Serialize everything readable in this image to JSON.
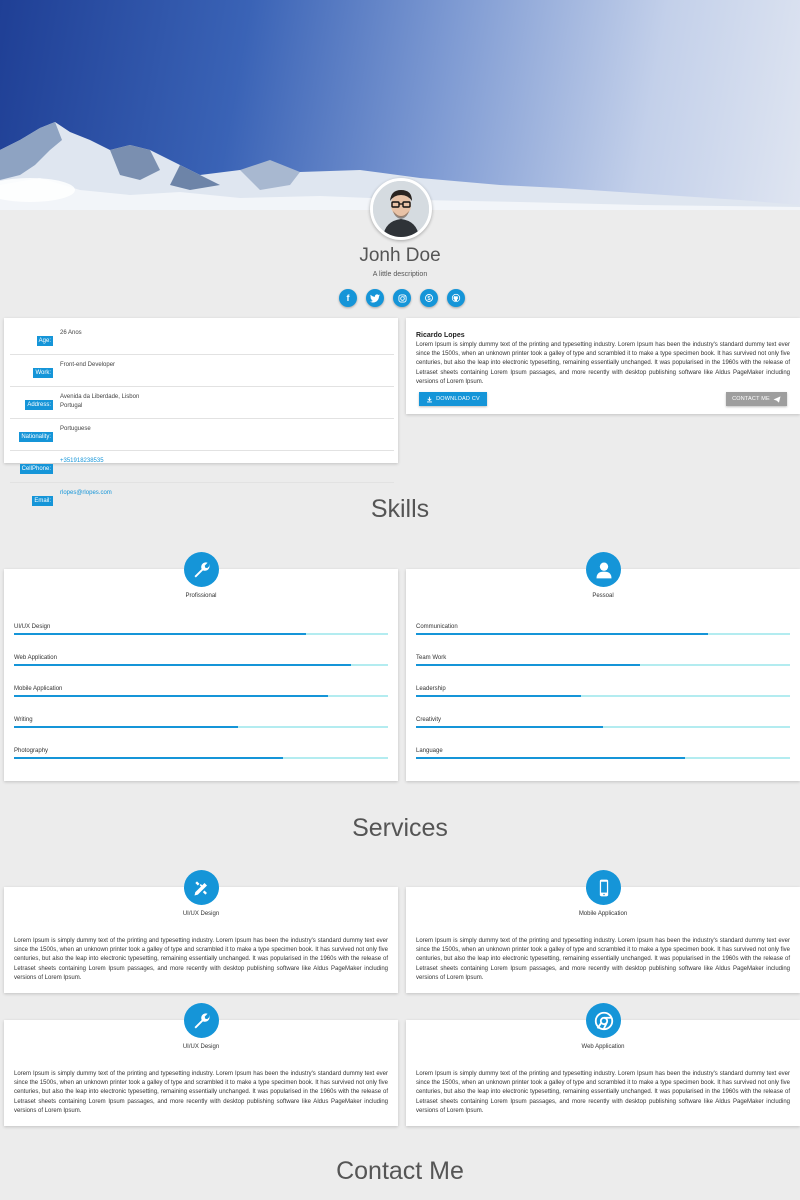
{
  "profile": {
    "name": "Jonh Doe",
    "description": "A little description",
    "avatar_icon": "avatar-photo",
    "socials": [
      {
        "icon": "facebook-icon",
        "glyph": "f"
      },
      {
        "icon": "twitter-icon",
        "glyph": "t"
      },
      {
        "icon": "instagram-icon",
        "glyph": "◎"
      },
      {
        "icon": "skype-icon",
        "glyph": "S"
      },
      {
        "icon": "github-icon",
        "glyph": "⌂"
      }
    ]
  },
  "info": {
    "rows": [
      {
        "key": "Age:",
        "value": "26 Anos",
        "value2": ""
      },
      {
        "key": "Work:",
        "value": "Front-end Developer",
        "value2": ""
      },
      {
        "key": "Address:",
        "value": "Avenida da Liberdade, Lisbon",
        "value2": "Portugal"
      },
      {
        "key": "Nationality:",
        "value": "Portuguese",
        "value2": ""
      },
      {
        "key": "CellPhone:",
        "value": "+351918238535",
        "value2": ""
      },
      {
        "key": "Email:",
        "value": "rlopes@rlopes.com",
        "value2": ""
      }
    ]
  },
  "bio": {
    "name": "Ricardo Lopes",
    "text": "Lorem Ipsum is simply dummy text of the printing and typesetting industry. Lorem Ipsum has been the industry's standard dummy text ever since the 1500s, when an unknown printer took a galley of type and scrambled it to make a type specimen book. It has survived not only five centuries, but also the leap into electronic typesetting, remaining essentially unchanged. It was popularised in the 1960s with the release of Letraset sheets containing Lorem Ipsum passages, and more recently with desktop publishing software like Aldus PageMaker including versions of Lorem Ipsum.",
    "download_label": "DOWNLOAD CV",
    "contact_label": "CONTACT ME"
  },
  "skills": {
    "title": "Skills",
    "groups": [
      {
        "title": "Profissional",
        "icon": "wrench-icon",
        "items": [
          {
            "name": "UI/UX Design",
            "level": 0.78
          },
          {
            "name": "Web Application",
            "level": 0.9
          },
          {
            "name": "Mobile Application",
            "level": 0.84
          },
          {
            "name": "Writing",
            "level": 0.6
          },
          {
            "name": "Photography",
            "level": 0.72
          }
        ]
      },
      {
        "title": "Pessoal",
        "icon": "user-icon",
        "items": [
          {
            "name": "Communication",
            "level": 0.78
          },
          {
            "name": "Team Work",
            "level": 0.6
          },
          {
            "name": "Leadership",
            "level": 0.44
          },
          {
            "name": "Creativity",
            "level": 0.5
          },
          {
            "name": "Language",
            "level": 0.72
          }
        ]
      }
    ]
  },
  "services": {
    "title": "Services",
    "items": [
      {
        "title": "UI/UX Design",
        "icon": "design-tools-icon",
        "text": "Lorem Ipsum is simply dummy text of the printing and typesetting industry. Lorem Ipsum has been the industry's standard dummy text ever since the 1500s, when an unknown printer took a galley of type and scrambled it to make a type specimen book. It has survived not only five centuries, but also the leap into electronic typesetting, remaining essentially unchanged. It was popularised in the 1960s with the release of Letraset sheets containing Lorem Ipsum passages, and more recently with desktop publishing software like Aldus PageMaker including versions of Lorem Ipsum."
      },
      {
        "title": "Mobile Application",
        "icon": "mobile-phone-icon",
        "text": "Lorem Ipsum is simply dummy text of the printing and typesetting industry. Lorem Ipsum has been the industry's standard dummy text ever since the 1500s, when an unknown printer took a galley of type and scrambled it to make a type specimen book. It has survived not only five centuries, but also the leap into electronic typesetting, remaining essentially unchanged. It was popularised in the 1960s with the release of Letraset sheets containing Lorem Ipsum passages, and more recently with desktop publishing software like Aldus PageMaker including versions of Lorem Ipsum."
      },
      {
        "title": "UI/UX Design",
        "icon": "wrench-icon",
        "text": "Lorem Ipsum is simply dummy text of the printing and typesetting industry. Lorem Ipsum has been the industry's standard dummy text ever since the 1500s, when an unknown printer took a galley of type and scrambled it to make a type specimen book. It has survived not only five centuries, but also the leap into electronic typesetting, remaining essentially unchanged. It was popularised in the 1960s with the release of Letraset sheets containing Lorem Ipsum passages, and more recently with desktop publishing software like Aldus PageMaker including versions of Lorem Ipsum."
      },
      {
        "title": "Web Application",
        "icon": "chrome-icon",
        "text": "Lorem Ipsum is simply dummy text of the printing and typesetting industry. Lorem Ipsum has been the industry's standard dummy text ever since the 1500s, when an unknown printer took a galley of type and scrambled it to make a type specimen book. It has survived not only five centuries, but also the leap into electronic typesetting, remaining essentially unchanged. It was popularised in the 1960s with the release of Letraset sheets containing Lorem Ipsum passages, and more recently with desktop publishing software like Aldus PageMaker including versions of Lorem Ipsum."
      }
    ]
  },
  "contact": {
    "title": "Contact Me"
  },
  "colors": {
    "accent": "#1595d8",
    "bar_track": "#b3ecf0",
    "background": "#ececec"
  }
}
